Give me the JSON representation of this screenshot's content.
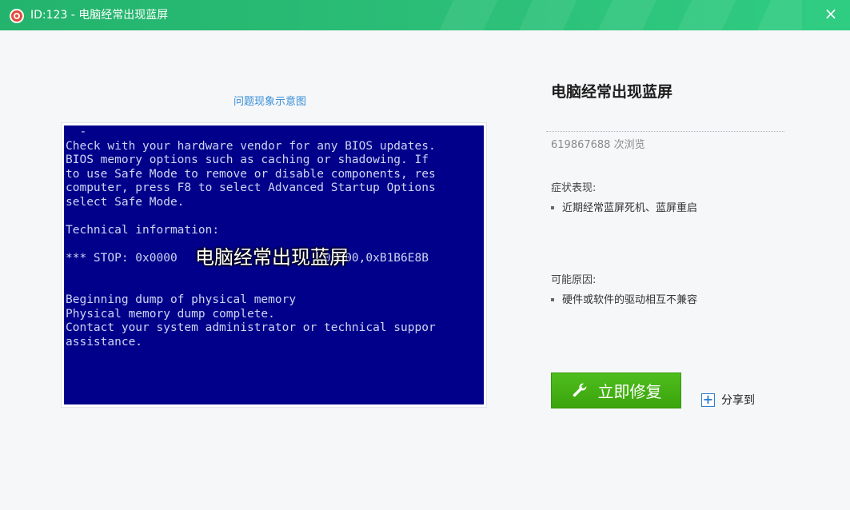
{
  "window": {
    "title": "ID:123 - 电脑经常出现蓝屏",
    "close_symbol": "×",
    "icon": "lifebuoy-icon",
    "accent_color": "#2cc079"
  },
  "left_panel": {
    "caption": "问题现象示意图",
    "screenshot_overlay": "电脑经常出现蓝屏",
    "bsod_lines": [
      "  -",
      "Check with your hardware vendor for any BIOS updates.",
      "BIOS memory options such as caching or shadowing. If",
      "to use Safe Mode to remove or disable components, res",
      "computer, press F8 to select Advanced Startup Options",
      "select Safe Mode.",
      "",
      "Technical information:",
      "",
      "*** STOP: 0x0000                     00000,0xB1B6E8B",
      "",
      "",
      "Beginning dump of physical memory",
      "Physical memory dump complete.",
      "Contact your system administrator or technical suppor",
      "assistance."
    ],
    "bsod_color": "#00008a"
  },
  "right_panel": {
    "title": "电脑经常出现蓝屏",
    "views": "619867688 次浏览",
    "symptoms_label": "症状表现:",
    "symptoms": [
      "近期经常蓝屏死机、蓝屏重启"
    ],
    "causes_label": "可能原因:",
    "causes": [
      "硬件或软件的驱动相互不兼容"
    ],
    "fix_button": "立即修复",
    "fix_icon": "wrench-icon",
    "fix_color": "#43b115",
    "share_label": "分享到",
    "share_icon": "plus-icon"
  }
}
